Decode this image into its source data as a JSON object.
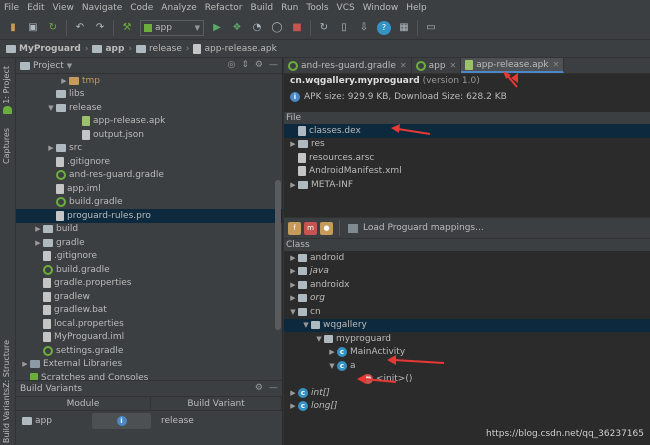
{
  "menu": [
    "File",
    "Edit",
    "View",
    "Navigate",
    "Code",
    "Analyze",
    "Refactor",
    "Build",
    "Run",
    "Tools",
    "VCS",
    "Window",
    "Help"
  ],
  "toolbar": {
    "run_config": "app"
  },
  "breadcrumbs": [
    "MyProguard",
    "app",
    "release",
    "app-release.apk"
  ],
  "left_strip": {
    "project_tab": "1: Project",
    "captures_tab": "Captures",
    "structure_tab": "Z: Structure",
    "variants_tab": "Build Variants"
  },
  "project_panel": {
    "title": "Project"
  },
  "project_tree": [
    {
      "label": "tmp",
      "icon": "folder-orange",
      "indent": 3,
      "toggle": "right"
    },
    {
      "label": "libs",
      "icon": "folder",
      "indent": 2,
      "toggle": ""
    },
    {
      "label": "release",
      "icon": "folder",
      "indent": 2,
      "toggle": "down"
    },
    {
      "label": "app-release.apk",
      "icon": "apk-file",
      "indent": 4,
      "toggle": ""
    },
    {
      "label": "output.json",
      "icon": "json-file",
      "indent": 4,
      "toggle": ""
    },
    {
      "label": "src",
      "icon": "folder",
      "indent": 2,
      "toggle": "right"
    },
    {
      "label": ".gitignore",
      "icon": "file",
      "indent": 2,
      "toggle": ""
    },
    {
      "label": "and-res-guard.gradle",
      "icon": "gradle",
      "indent": 2,
      "toggle": ""
    },
    {
      "label": "app.iml",
      "icon": "file",
      "indent": 2,
      "toggle": ""
    },
    {
      "label": "build.gradle",
      "icon": "gradle",
      "indent": 2,
      "toggle": ""
    },
    {
      "label": "proguard-rules.pro",
      "icon": "file",
      "indent": 2,
      "toggle": "",
      "selected": true
    },
    {
      "label": "build",
      "icon": "folder",
      "indent": 1,
      "toggle": "right"
    },
    {
      "label": "gradle",
      "icon": "folder",
      "indent": 1,
      "toggle": "right"
    },
    {
      "label": ".gitignore",
      "icon": "file",
      "indent": 1,
      "toggle": ""
    },
    {
      "label": "build.gradle",
      "icon": "gradle",
      "indent": 1,
      "toggle": ""
    },
    {
      "label": "gradle.properties",
      "icon": "file",
      "indent": 1,
      "toggle": ""
    },
    {
      "label": "gradlew",
      "icon": "file",
      "indent": 1,
      "toggle": ""
    },
    {
      "label": "gradlew.bat",
      "icon": "file",
      "indent": 1,
      "toggle": ""
    },
    {
      "label": "local.properties",
      "icon": "file",
      "indent": 1,
      "toggle": ""
    },
    {
      "label": "MyProguard.iml",
      "icon": "file",
      "indent": 1,
      "toggle": ""
    },
    {
      "label": "settings.gradle",
      "icon": "gradle",
      "indent": 1,
      "toggle": ""
    },
    {
      "label": "External Libraries",
      "icon": "library",
      "indent": 0,
      "toggle": "right"
    },
    {
      "label": "Scratches and Consoles",
      "icon": "scratch",
      "indent": 0,
      "toggle": ""
    }
  ],
  "build_variants": {
    "title": "Build Variants",
    "col_module": "Module",
    "col_variant": "Build Variant",
    "module": "app",
    "variant": "release"
  },
  "tabs": [
    {
      "label": "and-res-guard.gradle",
      "icon": "gradle",
      "active": false
    },
    {
      "label": "app",
      "icon": "gradle",
      "active": false
    },
    {
      "label": "app-release.apk",
      "icon": "apk",
      "active": true
    }
  ],
  "apk": {
    "package": "cn.wqgallery.myproguard",
    "version": "(version 1.0)",
    "size_text": "APK size: 929.9 KB, Download Size: 628.2 KB"
  },
  "file_section": {
    "header": "File"
  },
  "files": [
    {
      "label": "classes.dex",
      "icon": "dex",
      "toggle": "",
      "selected": true
    },
    {
      "label": "res",
      "icon": "folder",
      "toggle": "right"
    },
    {
      "label": "resources.arsc",
      "icon": "file",
      "toggle": ""
    },
    {
      "label": "AndroidManifest.xml",
      "icon": "file",
      "toggle": ""
    },
    {
      "label": "META-INF",
      "icon": "folder",
      "toggle": "right"
    }
  ],
  "class_toolbar": {
    "load_mapping": "Load Proguard mappings..."
  },
  "class_section": {
    "header": "Class"
  },
  "classes": [
    {
      "label": "android",
      "icon": "package",
      "indent": 0,
      "toggle": "right",
      "italic": false
    },
    {
      "label": "java",
      "icon": "package",
      "indent": 0,
      "toggle": "right",
      "italic": true
    },
    {
      "label": "androidx",
      "icon": "package",
      "indent": 0,
      "toggle": "right",
      "italic": false
    },
    {
      "label": "org",
      "icon": "package",
      "indent": 0,
      "toggle": "right",
      "italic": true
    },
    {
      "label": "cn",
      "icon": "package",
      "indent": 0,
      "toggle": "down",
      "italic": false
    },
    {
      "label": "wqgallery",
      "icon": "package",
      "indent": 1,
      "toggle": "down",
      "italic": false,
      "selected": true
    },
    {
      "label": "myproguard",
      "icon": "package",
      "indent": 2,
      "toggle": "down",
      "italic": false
    },
    {
      "label": "MainActivity",
      "icon": "class",
      "indent": 3,
      "toggle": "right",
      "italic": false
    },
    {
      "label": "a",
      "icon": "class",
      "indent": 3,
      "toggle": "down",
      "italic": false
    },
    {
      "label": "<init>()",
      "icon": "method",
      "indent": 5,
      "toggle": "",
      "italic": false
    },
    {
      "label": "int[]",
      "icon": "class",
      "indent": 0,
      "toggle": "right",
      "italic": true
    },
    {
      "label": "long[]",
      "icon": "class",
      "indent": 0,
      "toggle": "right",
      "italic": true
    }
  ],
  "watermark": "https://blog.csdn.net/qq_36237165",
  "colors": {
    "accent": "#4a88c7",
    "annotation": "#e53935",
    "selection": "#0d293e",
    "gradle": "#6cae3d"
  }
}
